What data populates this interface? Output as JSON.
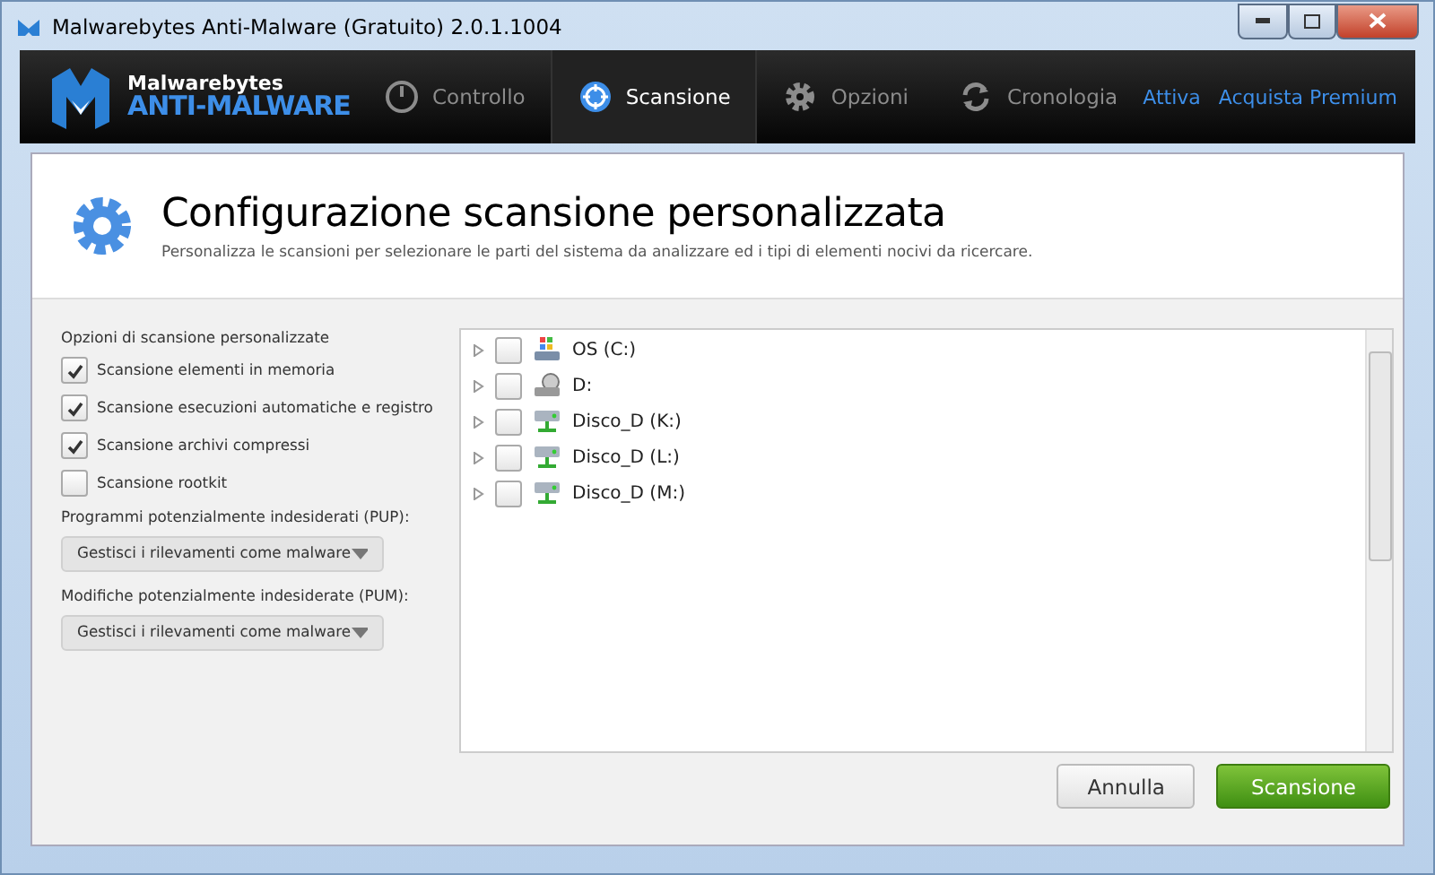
{
  "window": {
    "title": "Malwarebytes Anti-Malware (Gratuito) 2.0.1.1004"
  },
  "brand": {
    "top": "Malwarebytes",
    "bottom": "ANTI-MALWARE"
  },
  "nav": [
    {
      "label": "Controllo",
      "kind": "gauge",
      "selected": false
    },
    {
      "label": "Scansione",
      "kind": "target",
      "selected": true
    },
    {
      "label": "Opzioni",
      "kind": "gear",
      "selected": false
    },
    {
      "label": "Cronologia",
      "kind": "refresh",
      "selected": false
    }
  ],
  "links": [
    "Attiva",
    "Acquista Premium"
  ],
  "header": {
    "title": "Configurazione scansione personalizzata",
    "subtitle": "Personalizza le scansioni per selezionare le parti del sistema da analizzare ed i tipi di elementi nocivi da ricercare."
  },
  "options": {
    "title": "Opzioni di scansione personalizzate",
    "checks": [
      {
        "label": "Scansione elementi in memoria",
        "checked": true
      },
      {
        "label": "Scansione esecuzioni automatiche e registro",
        "checked": true
      },
      {
        "label": "Scansione archivi compressi",
        "checked": true
      },
      {
        "label": "Scansione rootkit",
        "checked": false
      }
    ],
    "selects": [
      {
        "label": "Programmi potenzialmente indesiderati (PUP):",
        "value": "Gestisci i rilevamenti come malware"
      },
      {
        "label": "Modifiche potenzialmente indesiderate (PUM):",
        "value": "Gestisci i rilevamenti come malware"
      }
    ]
  },
  "drives": [
    {
      "label": "OS (C:)",
      "kind": "system",
      "checked": false,
      "expanded": false
    },
    {
      "label": "D:",
      "kind": "optical",
      "checked": false,
      "expanded": false
    },
    {
      "label": "Disco_D (K:)",
      "kind": "network",
      "checked": false,
      "expanded": false
    },
    {
      "label": "Disco_D (L:)",
      "kind": "network",
      "checked": false,
      "expanded": false
    },
    {
      "label": "Disco_D (M:)",
      "kind": "network",
      "checked": false,
      "expanded": false
    }
  ],
  "buttons": {
    "cancel": "Annulla",
    "scan": "Scansione"
  }
}
